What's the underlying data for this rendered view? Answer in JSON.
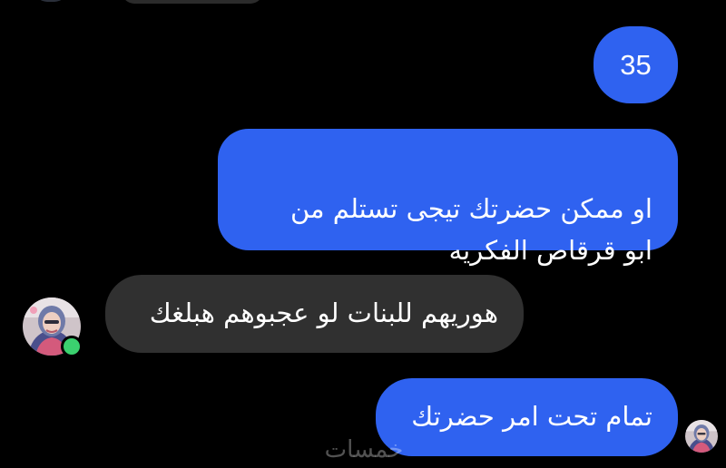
{
  "conversation": {
    "messages": [
      {
        "direction": "outgoing",
        "text": "35"
      },
      {
        "direction": "outgoing",
        "text": "او ممكن حضرتك تيجى تستلم من\nابو قرقاص الفكريه"
      },
      {
        "direction": "incoming",
        "text": "هوريهم للبنات لو عجبوهم هبلغك"
      },
      {
        "direction": "outgoing",
        "text": "تمام تحت امر حضرتك"
      }
    ],
    "contact": {
      "online": true
    },
    "watermark": "خمسات"
  },
  "colors": {
    "background": "#000000",
    "outgoing_bubble": "#2f62f0",
    "incoming_bubble": "#303030",
    "online_indicator": "#3bd16f",
    "text": "#ffffff"
  },
  "icons": {
    "contact_avatar": "profile-photo-icon",
    "self_avatar": "seen-profile-photo-icon"
  }
}
